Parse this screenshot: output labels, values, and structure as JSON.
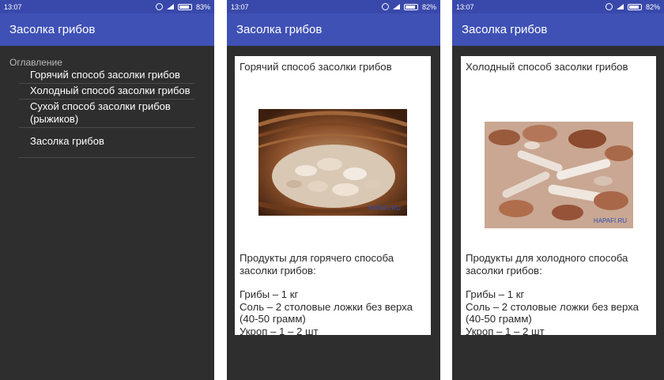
{
  "screens": [
    {
      "status": {
        "time": "13:07",
        "battery": "83%"
      },
      "title": "Засолка грибов",
      "toc": {
        "header": "Оглавление",
        "items": [
          "Горячий способ засолки грибов",
          "Холодный способ засолки грибов",
          "Сухой способ засолки грибов (рыжиков)",
          "Засолка грибов"
        ]
      }
    },
    {
      "status": {
        "time": "13:07",
        "battery": "82%"
      },
      "title": "Засолка грибов",
      "article": {
        "title": "Горячий способ засолки грибов",
        "photo_watermark": "HAPAFI.RU",
        "intro": "Продукты для горячего способа засолки грибов:",
        "lines": "Грибы – 1 кг\nСоль – 2 столовые ложки без верха (40-50 грамм)\nУкроп – 1 – 2 шт"
      }
    },
    {
      "status": {
        "time": "13:07",
        "battery": "82%"
      },
      "title": "Засолка грибов",
      "article": {
        "title": "Холодный способ засолки грибов",
        "photo_watermark": "HAPAFI.RU",
        "intro": "Продукты для холодного способа засолки грибов:",
        "lines": "Грибы – 1 кг\nСоль – 2 столовые ложки без верха (40-50 грамм)\nУкроп – 1 – 2 шт"
      }
    }
  ],
  "colors": {
    "statusbar": "#3949ab",
    "appbar": "#3f51b5",
    "drawer_bg": "#2e2e2e",
    "card_bg": "#ffffff"
  }
}
